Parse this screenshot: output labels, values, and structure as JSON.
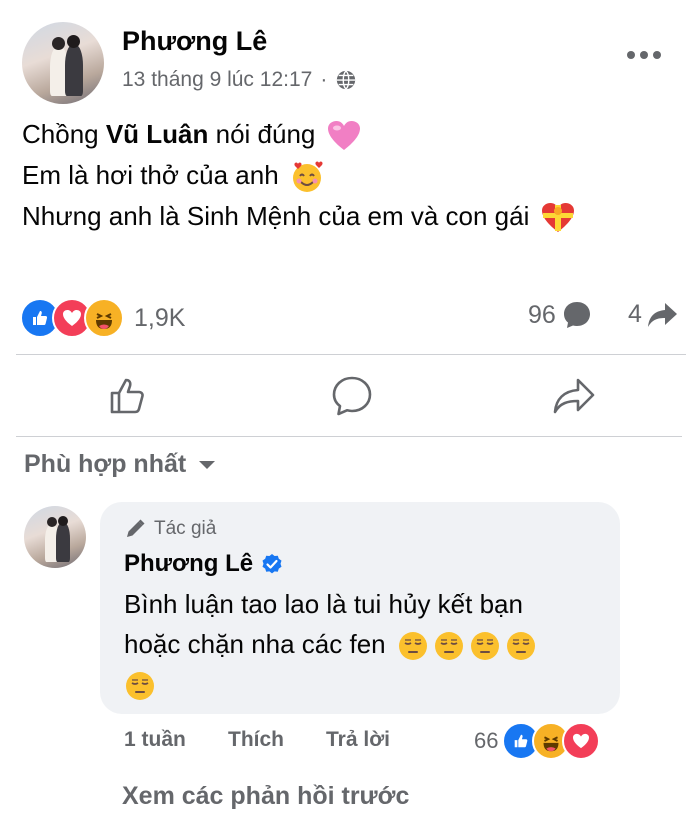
{
  "post": {
    "author": "Phương Lê",
    "timestamp": "13 tháng 9 lúc 12:17",
    "privacy_icon": "globe-icon",
    "body": {
      "line1_prefix": "Chồng ",
      "line1_mention": "Vũ Luân",
      "line1_suffix": " nói đúng",
      "line1_emoji": "pink-heart",
      "line2": "Em là hơi thở của anh",
      "line2_emoji": "smiling-face-with-hearts",
      "line3": "Nhưng anh là Sinh Mệnh của em và con gái",
      "line3_emoji": "heart-with-ribbon"
    },
    "reactions": {
      "types": [
        "like",
        "love",
        "haha"
      ],
      "count": "1,9K"
    },
    "comments_count": "96",
    "shares_count": "4"
  },
  "actions": {
    "like_icon": "thumbs-up-icon",
    "comment_icon": "comment-bubble-icon",
    "share_icon": "share-arrow-icon"
  },
  "sort": {
    "label": "Phù hợp nhất"
  },
  "comment": {
    "badge": "Tác giả",
    "author": "Phương Lê",
    "verified": true,
    "text_line1": "Bình luận tao lao là tui hủy kết bạn",
    "text_line2": "hoặc chặn nha các fen",
    "emoji": "relieved-face",
    "emoji_count": 5,
    "time": "1 tuần",
    "like_label": "Thích",
    "reply_label": "Trả lời",
    "reaction_count": "66",
    "reaction_types": [
      "like",
      "haha",
      "love"
    ]
  },
  "view_previous_replies": "Xem các phản hồi trước",
  "colors": {
    "like_blue": "#1877f2",
    "love_red": "#f33e58",
    "haha_yellow": "#f7b125",
    "secondary_text": "#65676b",
    "bubble_bg": "#f0f2f5",
    "pink_heart": "#f17fc4"
  }
}
